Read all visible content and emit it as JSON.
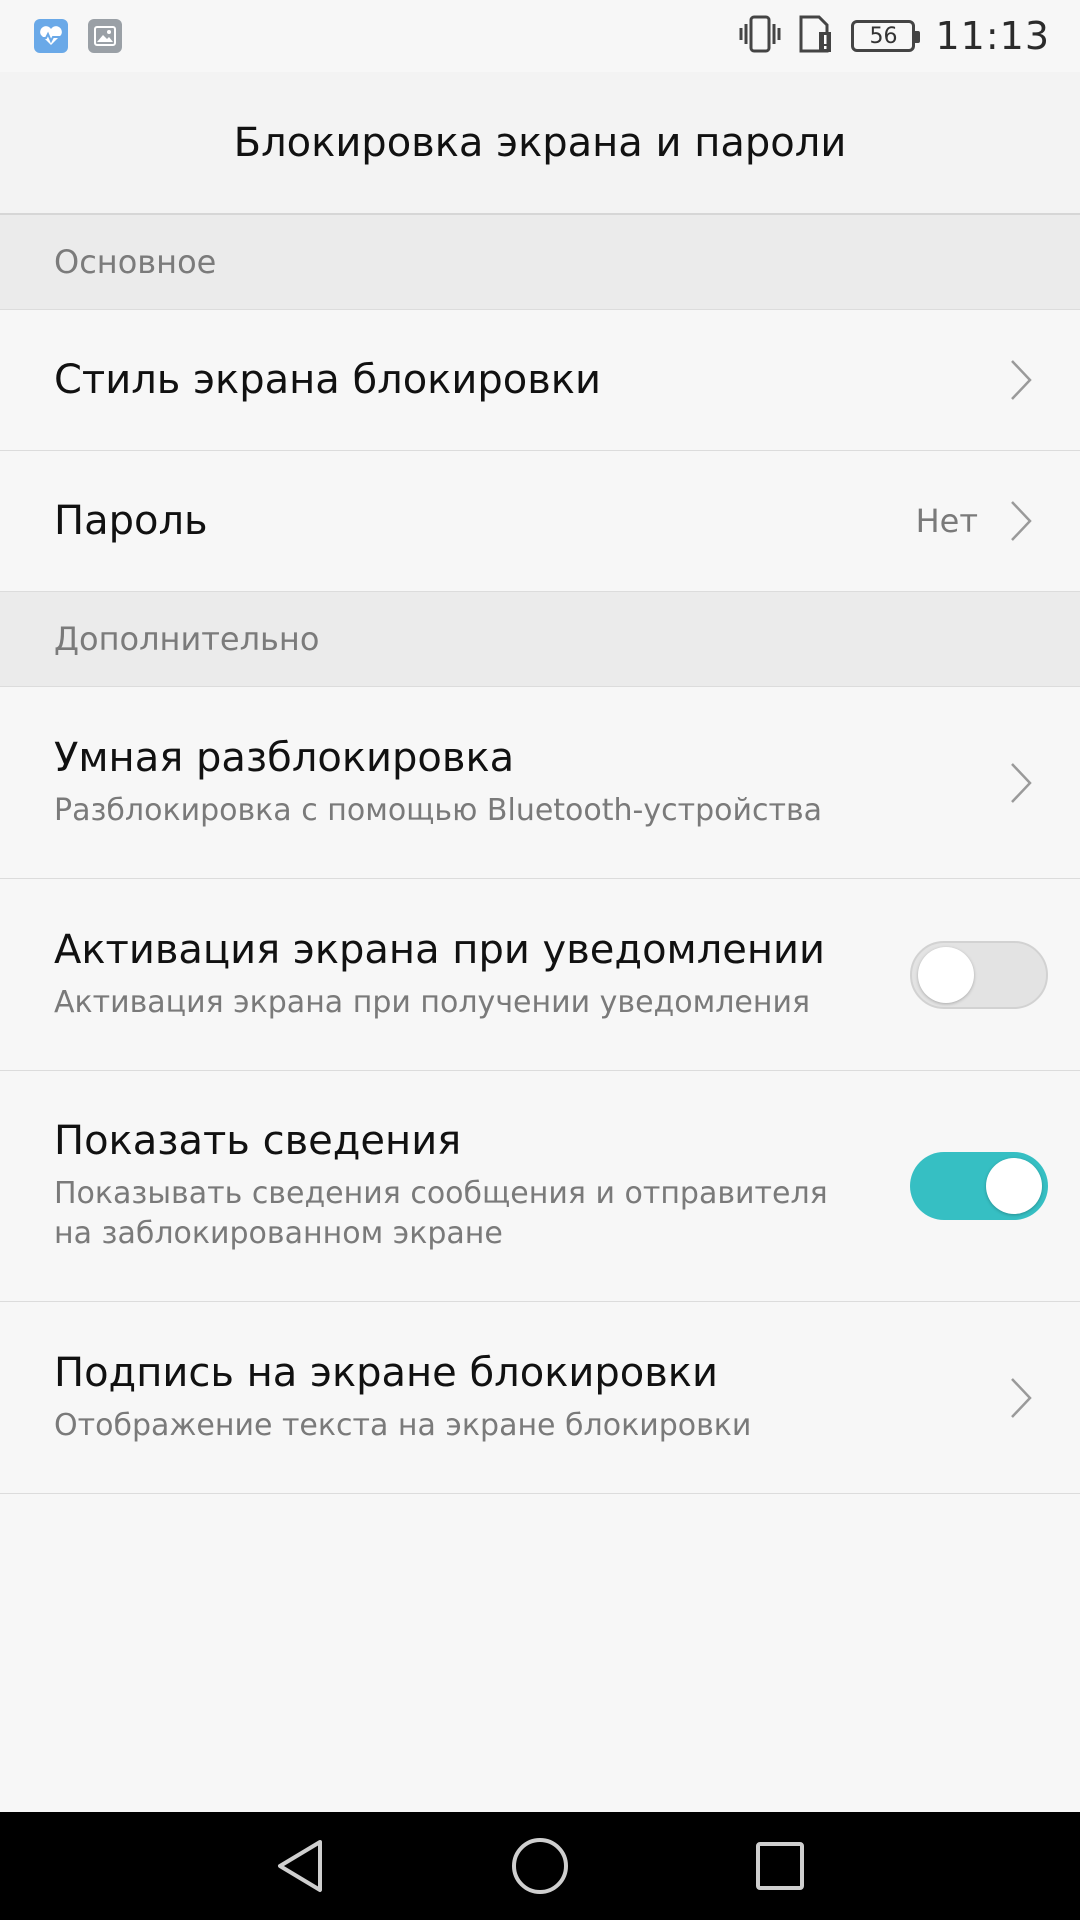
{
  "status_bar": {
    "left_icons": [
      "health-app-icon",
      "gallery-icon"
    ],
    "right_icons": [
      "vibrate-icon",
      "sim-alert-icon"
    ],
    "battery": "56",
    "time": "11:13"
  },
  "app_bar": {
    "title": "Блокировка экрана и пароли"
  },
  "sections": [
    {
      "header": "Основное",
      "items": [
        {
          "title": "Стиль экрана блокировки",
          "control": "chevron"
        },
        {
          "title": "Пароль",
          "value": "Нет",
          "control": "chevron"
        }
      ]
    },
    {
      "header": "Дополнительно",
      "items": [
        {
          "title": "Умная разблокировка",
          "subtitle": "Разблокировка с помощью Bluetooth-устройства",
          "control": "chevron"
        },
        {
          "title": "Активация экрана при уведомлении",
          "subtitle": "Активация экрана при получении уведомления",
          "control": "switch",
          "enabled": false
        },
        {
          "title": "Показать сведения",
          "subtitle": "Показывать сведения сообщения и отправителя на заблокированном экране",
          "control": "switch",
          "enabled": true
        },
        {
          "title": "Подпись на экране блокировки",
          "subtitle": "Отображение текста на экране блокировки",
          "control": "chevron"
        }
      ]
    }
  ],
  "nav_bar": {
    "icons": [
      "back-icon",
      "home-icon",
      "recents-icon"
    ]
  },
  "colors": {
    "accent": "#36bfc3",
    "background": "#f7f7f7",
    "section_bg": "#ebebeb"
  }
}
